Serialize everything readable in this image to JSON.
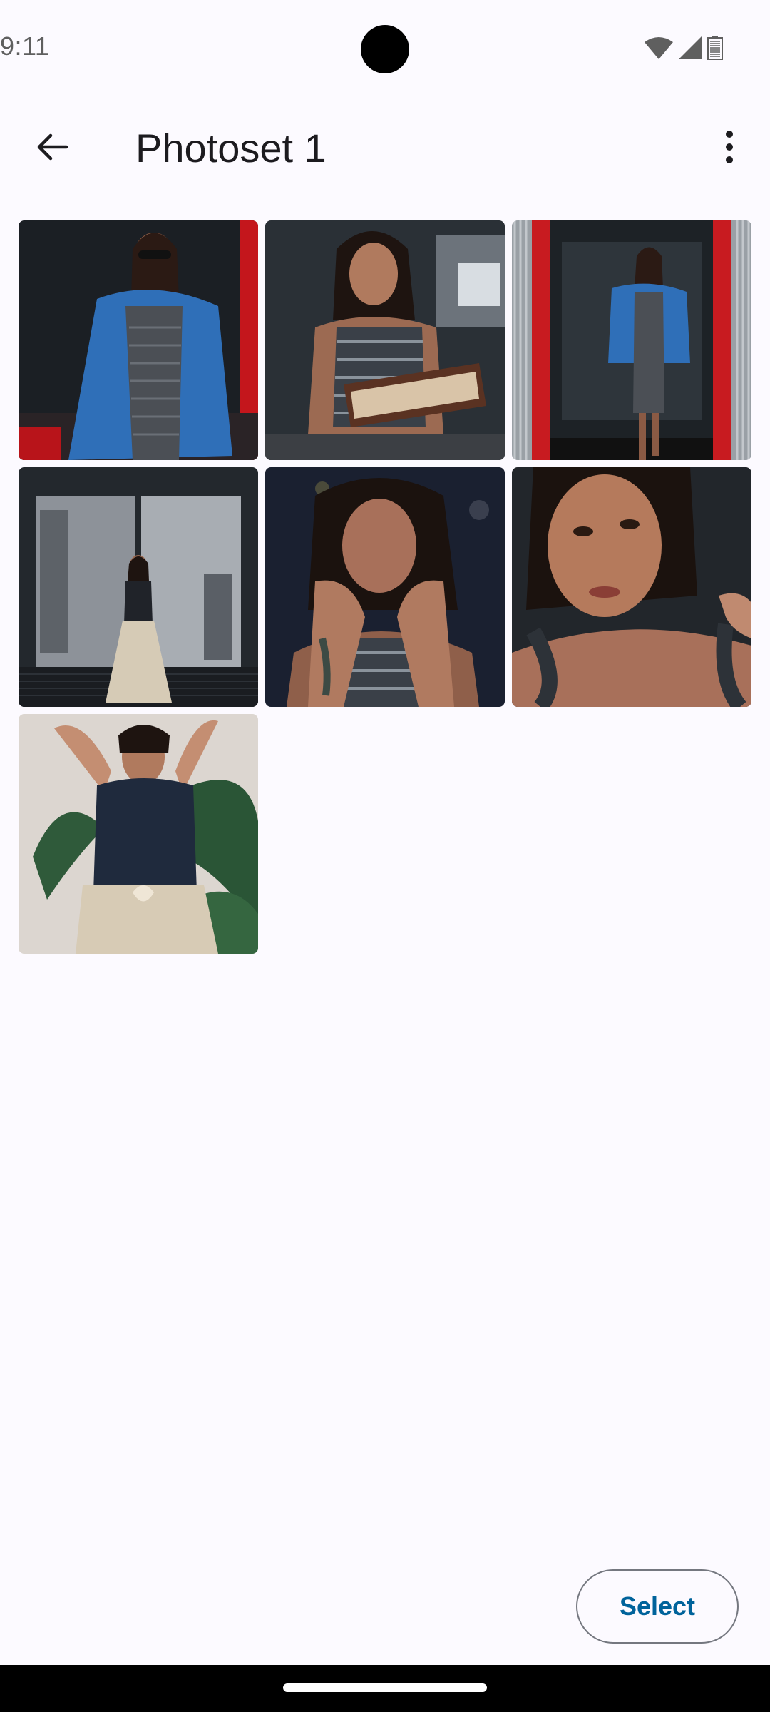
{
  "status_bar": {
    "time": "9:11",
    "icons": [
      "wifi-icon",
      "signal-icon",
      "battery-icon"
    ]
  },
  "app_bar": {
    "back_icon": "arrow-back-icon",
    "title": "Photoset 1",
    "overflow_icon": "more-vert-icon"
  },
  "photos": [
    {
      "subject": "woman in denim jacket and sunglasses by red window"
    },
    {
      "subject": "woman reading a book behind glass"
    },
    {
      "subject": "woman in denim jacket standing in red doorway"
    },
    {
      "subject": "woman in skirt standing by large window"
    },
    {
      "subject": "woman resting chin on hands"
    },
    {
      "subject": "close-up portrait of woman"
    },
    {
      "subject": "woman with arms raised near plant"
    }
  ],
  "select_button": {
    "label": "Select"
  },
  "colors": {
    "background": "#fcfaff",
    "accent": "#00639b",
    "outline": "#74777f",
    "nav_bar": "#000000"
  }
}
